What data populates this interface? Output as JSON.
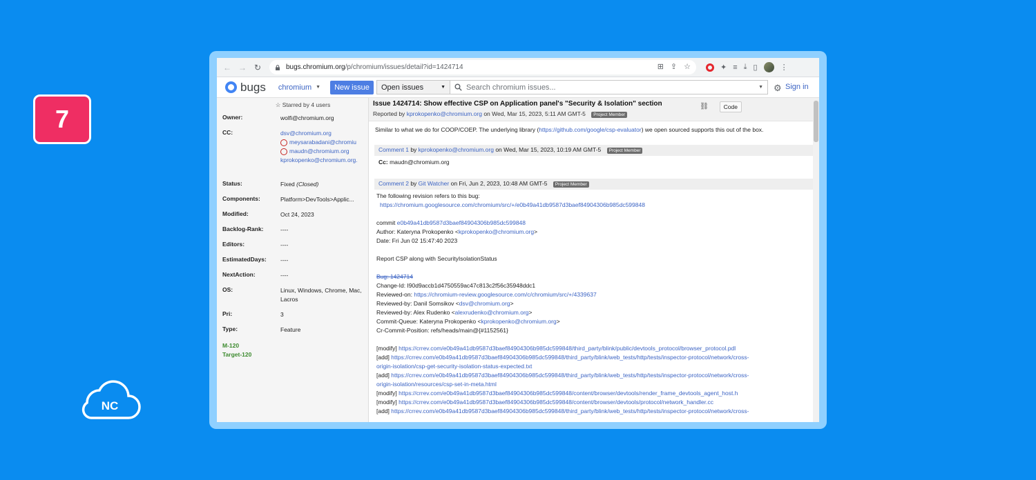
{
  "badge": {
    "number": "7"
  },
  "logo": {
    "text": "NC"
  },
  "browser": {
    "url_host": "bugs.chromium.org",
    "url_path": "/p/chromium/issues/detail?id=1424714"
  },
  "appbar": {
    "brand": "bugs",
    "project": "chromium",
    "new_issue": "New issue",
    "search_scope": "Open issues",
    "search_placeholder": "Search chromium issues...",
    "sign_in": "Sign in"
  },
  "side": {
    "starred": "Starred by 4 users",
    "owner_label": "Owner:",
    "owner": "wolfi@chromium.org",
    "cc_label": "CC:",
    "cc": [
      "dsv@chromium.org",
      "meysarabadani@chromiu",
      "maudn@chromium.org",
      "kprokopenko@chromium.org."
    ],
    "status_label": "Status:",
    "status": "Fixed",
    "status_note": "(Closed)",
    "components_label": "Components:",
    "components": "Platform>DevTools>Applic...",
    "modified_label": "Modified:",
    "modified": "Oct 24, 2023",
    "backlog_label": "Backlog-Rank:",
    "backlog": "----",
    "editors_label": "Editors:",
    "editors": "----",
    "estimated_label": "EstimatedDays:",
    "estimated": "----",
    "next_label": "NextAction:",
    "next": "----",
    "os_label": "OS:",
    "os": "Linux, Windows, Chrome, Mac, Lacros",
    "pri_label": "Pri:",
    "pri": "3",
    "type_label": "Type:",
    "type": "Feature",
    "milestones": [
      "M-120",
      "Target-120"
    ]
  },
  "issue": {
    "title": "Issue 1424714: Show effective CSP on Application panel's \"Security & Isolation\" section",
    "reported_prefix": "Reported by",
    "reporter": "kprokopenko@chromium.org",
    "reported_date": "on Wed, Mar 15, 2023, 5:11 AM GMT-5",
    "badge": "Project Member",
    "code_label": "Code",
    "desc_a": "Similar to what we do for COOP/COEP. The underlying library (",
    "desc_link": "https://github.com/google/csp-evaluator",
    "desc_b": ") we open sourced supports this out of the box."
  },
  "comment1": {
    "label": "Comment 1",
    "by": "by",
    "author": "kprokopenko@chromium.org",
    "date": "on Wed, Mar 15, 2023, 10:19 AM GMT-5",
    "badge": "Project Member",
    "cc_key": "Cc:",
    "cc_val": "maudn@chromium.org"
  },
  "comment2": {
    "label": "Comment 2",
    "by": "by",
    "author": "Git Watcher",
    "date": "on Fri, Jun 2, 2023, 10:48 AM GMT-5",
    "badge": "Project Member",
    "intro": "The following revision refers to this bug:",
    "rev_link": "https://chromium.googlesource.com/chromium/src/+/e0b49a41db9587d3baef84904306b985dc599848",
    "commit_prefix": "commit",
    "commit_hash": "e0b49a41db9587d3baef84904306b985dc599848",
    "author_line": "Author: Kateryna Prokopenko <",
    "author_email": "kprokopenko@chromium.org",
    "date_line": "Date: Fri Jun 02 15:47:40 2023",
    "summary": "Report CSP along with SecurityIsolationStatus",
    "bug_ref": "Bug: 1424714",
    "change_id": "Change-Id: I90d9accb1d4750559ac47c813c2f56c35948ddc1",
    "reviewed_on_prefix": "Reviewed-on:",
    "reviewed_on_link": "https://chromium-review.googlesource.com/c/chromium/src/+/4339637",
    "rb1_prefix": "Reviewed-by: Danil Somsikov <",
    "rb1_email": "dsv@chromium.org",
    "rb2_prefix": "Reviewed-by: Alex Rudenko <",
    "rb2_email": "alexrudenko@chromium.org",
    "cq_prefix": "Commit-Queue: Kateryna Prokopenko <",
    "cq_email": "kprokopenko@chromium.org",
    "cr_pos": "Cr-Commit-Position: refs/heads/main@{#1152561}",
    "files": [
      {
        "op": "[modify]",
        "link": "https://crrev.com/e0b49a41db9587d3baef84904306b985dc599848/third_party/blink/public/devtools_protocol/browser_protocol.pdl"
      },
      {
        "op": "[add]",
        "link": "https://crrev.com/e0b49a41db9587d3baef84904306b985dc599848/third_party/blink/web_tests/http/tests/inspector-protocol/network/cross-",
        "cont": "origin-isolation/csp-get-security-isolation-status-expected.txt"
      },
      {
        "op": "[add]",
        "link": "https://crrev.com/e0b49a41db9587d3baef84904306b985dc599848/third_party/blink/web_tests/http/tests/inspector-protocol/network/cross-",
        "cont": "origin-isolation/resources/csp-set-in-meta.html"
      },
      {
        "op": "[modify]",
        "link": "https://crrev.com/e0b49a41db9587d3baef84904306b985dc599848/content/browser/devtools/render_frame_devtools_agent_host.h"
      },
      {
        "op": "[modify]",
        "link": "https://crrev.com/e0b49a41db9587d3baef84904306b985dc599848/content/browser/devtools/protocol/network_handler.cc"
      },
      {
        "op": "[add]",
        "link": "https://crrev.com/e0b49a41db9587d3baef84904306b985dc599848/third_party/blink/web_tests/http/tests/inspector-protocol/network/cross-"
      }
    ]
  },
  "colors": {
    "background": "#0a8cf0",
    "badge": "#ef2e63",
    "link": "#3c64c4",
    "milestone": "#3c8a2e"
  }
}
